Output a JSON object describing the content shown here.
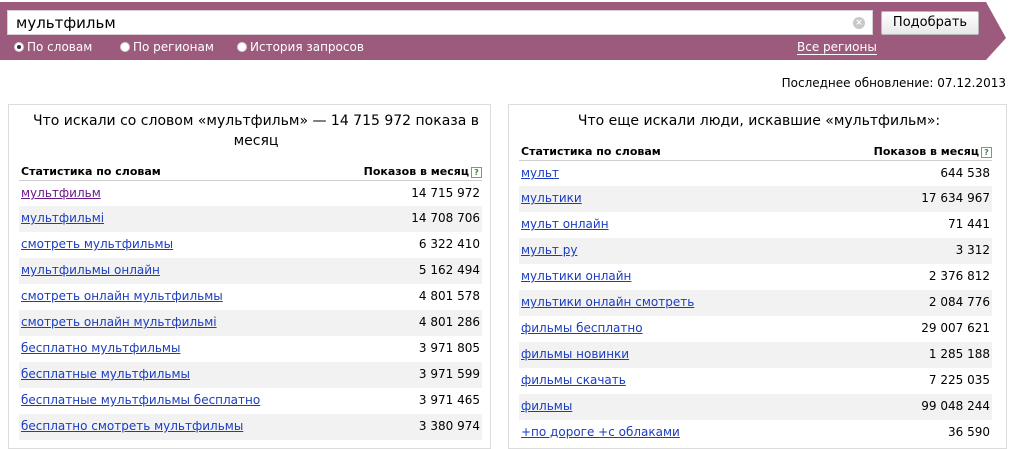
{
  "search": {
    "query": "мультфильм",
    "submit_label": "Подобрать",
    "clear_icon": "×"
  },
  "modes": [
    {
      "label": "По словам",
      "selected": true
    },
    {
      "label": "По регионам",
      "selected": false
    },
    {
      "label": "История запросов",
      "selected": false
    }
  ],
  "regions_link": "Все регионы",
  "last_update": "Последнее обновление: 07.12.2013",
  "colors": {
    "band": "#9c5a7c",
    "link": "#1a3dc1",
    "visited_link": "#6a1a8a"
  },
  "left_panel": {
    "title": "Что искали со словом «мультфильм» — 14 715 972 показа в месяц",
    "col_words": "Статистика по словам",
    "col_count": "Показов в месяц",
    "help_icon": "?",
    "rows": [
      {
        "keyword": "мультфильм",
        "count": "14 715 972",
        "visited": true
      },
      {
        "keyword": "мультфильмі",
        "count": "14 708 706",
        "visited": false
      },
      {
        "keyword": "смотреть мультфильмы",
        "count": "6 322 410",
        "visited": false
      },
      {
        "keyword": "мультфильмы онлайн",
        "count": "5 162 494",
        "visited": false
      },
      {
        "keyword": "смотреть онлайн мультфильмы",
        "count": "4 801 578",
        "visited": false
      },
      {
        "keyword": "смотреть онлайн мультфильмі",
        "count": "4 801 286",
        "visited": false
      },
      {
        "keyword": "бесплатно мультфильмы",
        "count": "3 971 805",
        "visited": false
      },
      {
        "keyword": "бесплатные мультфильмы",
        "count": "3 971 599",
        "visited": false
      },
      {
        "keyword": "бесплатные мультфильмы бесплатно",
        "count": "3 971 465",
        "visited": false
      },
      {
        "keyword": "бесплатно смотреть мультфильмы",
        "count": "3 380 974",
        "visited": false
      }
    ]
  },
  "right_panel": {
    "title": "Что еще искали люди, искавшие «мультфильм»:",
    "col_words": "Статистика по словам",
    "col_count": "Показов в месяц",
    "help_icon": "?",
    "rows": [
      {
        "keyword": "мульт",
        "count": "644 538"
      },
      {
        "keyword": "мультики",
        "count": "17 634 967"
      },
      {
        "keyword": "мульт онлайн",
        "count": "71 441"
      },
      {
        "keyword": "мульт ру",
        "count": "3 312"
      },
      {
        "keyword": "мультики онлайн",
        "count": "2 376 812"
      },
      {
        "keyword": "мультики онлайн смотреть",
        "count": "2 084 776"
      },
      {
        "keyword": "фильмы бесплатно",
        "count": "29 007 621"
      },
      {
        "keyword": "фильмы новинки",
        "count": "1 285 188"
      },
      {
        "keyword": "фильмы скачать",
        "count": "7 225 035"
      },
      {
        "keyword": "фильмы",
        "count": "99 048 244"
      },
      {
        "keyword": "+по дороге +с облаками",
        "count": "36 590"
      }
    ]
  }
}
